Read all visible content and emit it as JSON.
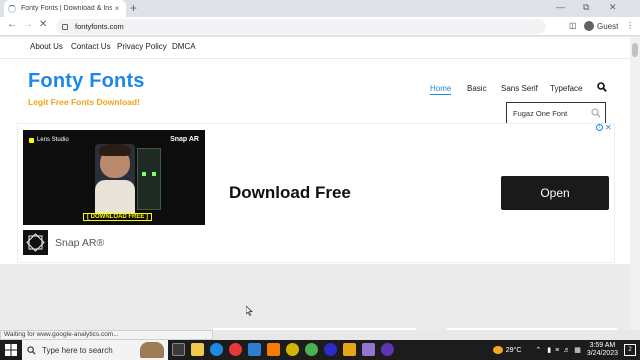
{
  "browser": {
    "tab_title": "Fonty Fonts | Download & Insta",
    "tab_close": "×",
    "new_tab": "+",
    "url": "fontyfonts.com",
    "profile": "Guest",
    "status_text": "Waiting for www.google-analytics.com..."
  },
  "site": {
    "top_links": [
      "About Us",
      "Contact Us",
      "Privacy Policy",
      "DMCA"
    ],
    "logo": "Fonty Fonts",
    "tagline": "Legit Free Fonts Download!",
    "nav": [
      "Home",
      "Basic",
      "Sans Serif",
      "Typeface"
    ],
    "active_nav": "Home",
    "search": {
      "value": "Fugaz One Font"
    }
  },
  "ad": {
    "video_brand": "Lens Studio",
    "video_logo": "Snap AR",
    "video_cta": "[ DOWNLOAD FREE ]",
    "brand": "Snap AR®",
    "headline": "Download Free",
    "button": "Open",
    "close": "✕"
  },
  "taskbar": {
    "search_placeholder": "Type here to search",
    "weather": "29°C",
    "time": "3:59 AM",
    "date": "3/24/2023",
    "notifications": "2"
  },
  "colors": {
    "accent": "#1e88e5",
    "tagline": "#f2a415",
    "ad_button": "#1a1a1a"
  }
}
